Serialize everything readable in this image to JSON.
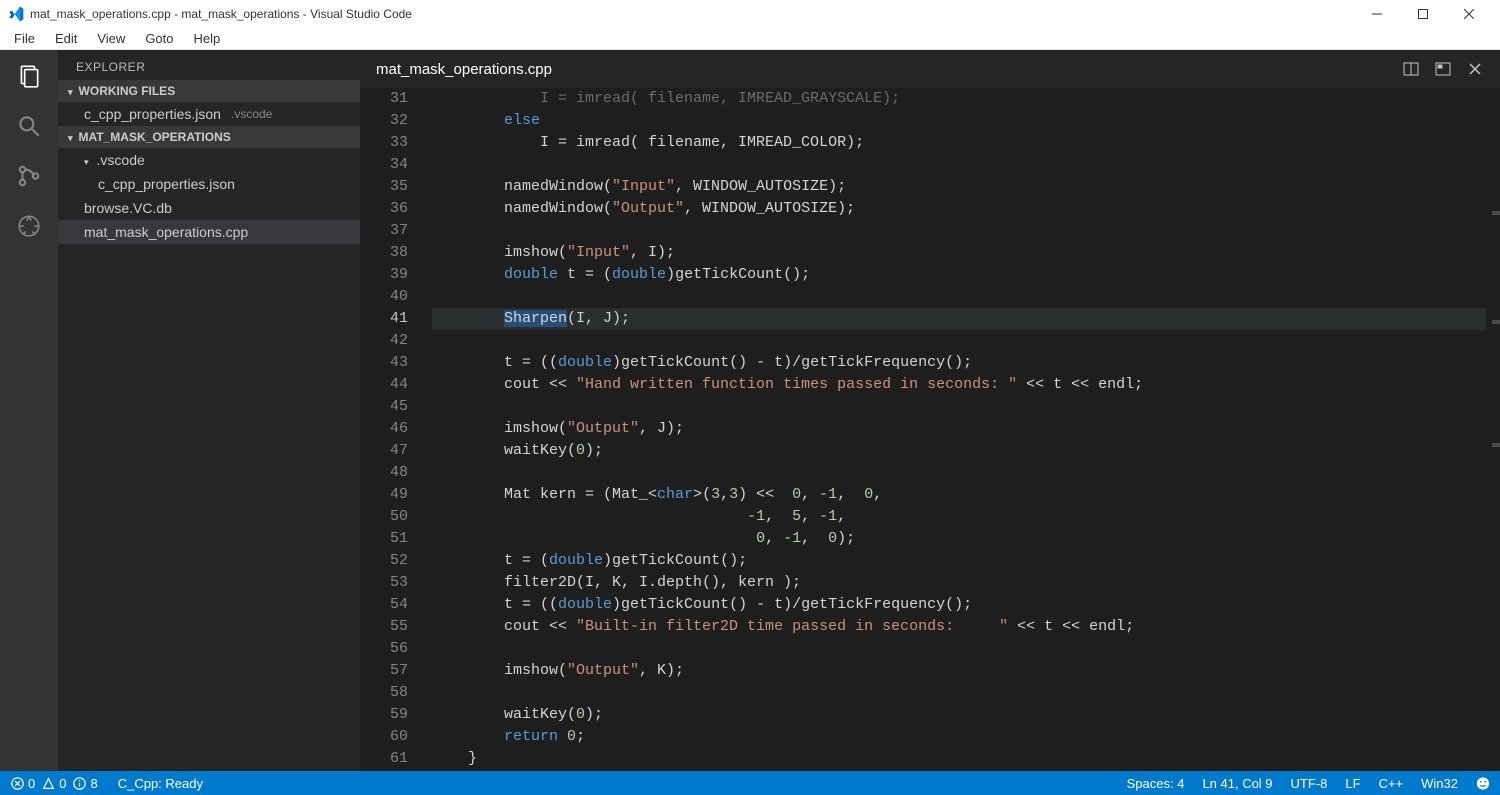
{
  "window": {
    "title": "mat_mask_operations.cpp - mat_mask_operations - Visual Studio Code"
  },
  "menu": {
    "items": [
      "File",
      "Edit",
      "View",
      "Goto",
      "Help"
    ]
  },
  "sidebar": {
    "title": "EXPLORER",
    "sections": {
      "working_files": {
        "label": "WORKING FILES",
        "items": [
          {
            "name": "c_cpp_properties.json",
            "dir": ".vscode"
          }
        ]
      },
      "project": {
        "label": "MAT_MASK_OPERATIONS",
        "items": [
          {
            "name": ".vscode",
            "kind": "folder",
            "children": [
              {
                "name": "c_cpp_properties.json",
                "kind": "file"
              }
            ]
          },
          {
            "name": "browse.VC.db",
            "kind": "file"
          },
          {
            "name": "mat_mask_operations.cpp",
            "kind": "file",
            "selected": true
          }
        ]
      }
    }
  },
  "editor": {
    "tab_title": "mat_mask_operations.cpp",
    "first_visible_line": 31,
    "current_line": 41,
    "lines": [
      {
        "n": 31,
        "tokens": [
          {
            "t": "            I = imread( filename, IMREAD_GRAYSCALE);",
            "c": ""
          }
        ],
        "dim": true
      },
      {
        "n": 32,
        "tokens": [
          {
            "t": "        ",
            "c": ""
          },
          {
            "t": "else",
            "c": "kw"
          }
        ]
      },
      {
        "n": 33,
        "tokens": [
          {
            "t": "            I = imread( filename, IMREAD_COLOR);",
            "c": ""
          }
        ]
      },
      {
        "n": 34,
        "tokens": [
          {
            "t": "",
            "c": ""
          }
        ]
      },
      {
        "n": 35,
        "tokens": [
          {
            "t": "        namedWindow(",
            "c": ""
          },
          {
            "t": "\"Input\"",
            "c": "str"
          },
          {
            "t": ", WINDOW_AUTOSIZE);",
            "c": ""
          }
        ]
      },
      {
        "n": 36,
        "tokens": [
          {
            "t": "        namedWindow(",
            "c": ""
          },
          {
            "t": "\"Output\"",
            "c": "str"
          },
          {
            "t": ", WINDOW_AUTOSIZE);",
            "c": ""
          }
        ]
      },
      {
        "n": 37,
        "tokens": [
          {
            "t": "",
            "c": ""
          }
        ]
      },
      {
        "n": 38,
        "tokens": [
          {
            "t": "        imshow(",
            "c": ""
          },
          {
            "t": "\"Input\"",
            "c": "str"
          },
          {
            "t": ", I);",
            "c": ""
          }
        ]
      },
      {
        "n": 39,
        "tokens": [
          {
            "t": "        ",
            "c": ""
          },
          {
            "t": "double",
            "c": "kw"
          },
          {
            "t": " t = (",
            "c": ""
          },
          {
            "t": "double",
            "c": "kw"
          },
          {
            "t": ")getTickCount();",
            "c": ""
          }
        ]
      },
      {
        "n": 40,
        "tokens": [
          {
            "t": "",
            "c": ""
          }
        ]
      },
      {
        "n": 41,
        "tokens": [
          {
            "t": "        ",
            "c": ""
          },
          {
            "t": "Sharpen",
            "c": "sel-hl"
          },
          {
            "t": "(I, J);",
            "c": ""
          }
        ]
      },
      {
        "n": 42,
        "tokens": [
          {
            "t": "",
            "c": ""
          }
        ]
      },
      {
        "n": 43,
        "tokens": [
          {
            "t": "        t = ((",
            "c": ""
          },
          {
            "t": "double",
            "c": "kw"
          },
          {
            "t": ")getTickCount() - t)/getTickFrequency();",
            "c": ""
          }
        ]
      },
      {
        "n": 44,
        "tokens": [
          {
            "t": "        cout << ",
            "c": ""
          },
          {
            "t": "\"Hand written function times passed in seconds: \"",
            "c": "str"
          },
          {
            "t": " << t << endl;",
            "c": ""
          }
        ]
      },
      {
        "n": 45,
        "tokens": [
          {
            "t": "",
            "c": ""
          }
        ]
      },
      {
        "n": 46,
        "tokens": [
          {
            "t": "        imshow(",
            "c": ""
          },
          {
            "t": "\"Output\"",
            "c": "str"
          },
          {
            "t": ", J);",
            "c": ""
          }
        ]
      },
      {
        "n": 47,
        "tokens": [
          {
            "t": "        waitKey(",
            "c": ""
          },
          {
            "t": "0",
            "c": "num"
          },
          {
            "t": ");",
            "c": ""
          }
        ]
      },
      {
        "n": 48,
        "tokens": [
          {
            "t": "",
            "c": ""
          }
        ]
      },
      {
        "n": 49,
        "tokens": [
          {
            "t": "        Mat kern = (Mat_<",
            "c": ""
          },
          {
            "t": "char",
            "c": "kw"
          },
          {
            "t": ">(",
            "c": ""
          },
          {
            "t": "3",
            "c": "num"
          },
          {
            "t": ",",
            "c": ""
          },
          {
            "t": "3",
            "c": "num"
          },
          {
            "t": ") <<  ",
            "c": ""
          },
          {
            "t": "0",
            "c": "num"
          },
          {
            "t": ", ",
            "c": ""
          },
          {
            "t": "-1",
            "c": "num"
          },
          {
            "t": ",  ",
            "c": ""
          },
          {
            "t": "0",
            "c": "num"
          },
          {
            "t": ",",
            "c": ""
          }
        ]
      },
      {
        "n": 50,
        "tokens": [
          {
            "t": "                                   ",
            "c": ""
          },
          {
            "t": "-1",
            "c": "num"
          },
          {
            "t": ",  ",
            "c": ""
          },
          {
            "t": "5",
            "c": "num"
          },
          {
            "t": ", ",
            "c": ""
          },
          {
            "t": "-1",
            "c": "num"
          },
          {
            "t": ",",
            "c": ""
          }
        ]
      },
      {
        "n": 51,
        "tokens": [
          {
            "t": "                                    ",
            "c": ""
          },
          {
            "t": "0",
            "c": "num"
          },
          {
            "t": ", ",
            "c": ""
          },
          {
            "t": "-1",
            "c": "num"
          },
          {
            "t": ",  ",
            "c": ""
          },
          {
            "t": "0",
            "c": "num"
          },
          {
            "t": ");",
            "c": ""
          }
        ]
      },
      {
        "n": 52,
        "tokens": [
          {
            "t": "        t = (",
            "c": ""
          },
          {
            "t": "double",
            "c": "kw"
          },
          {
            "t": ")getTickCount();",
            "c": ""
          }
        ]
      },
      {
        "n": 53,
        "tokens": [
          {
            "t": "        filter2D(I, K, I.depth(), kern );",
            "c": ""
          }
        ]
      },
      {
        "n": 54,
        "tokens": [
          {
            "t": "        t = ((",
            "c": ""
          },
          {
            "t": "double",
            "c": "kw"
          },
          {
            "t": ")getTickCount() - t)/getTickFrequency();",
            "c": ""
          }
        ]
      },
      {
        "n": 55,
        "tokens": [
          {
            "t": "        cout << ",
            "c": ""
          },
          {
            "t": "\"Built-in filter2D time passed in seconds:     \"",
            "c": "str"
          },
          {
            "t": " << t << endl;",
            "c": ""
          }
        ]
      },
      {
        "n": 56,
        "tokens": [
          {
            "t": "",
            "c": ""
          }
        ]
      },
      {
        "n": 57,
        "tokens": [
          {
            "t": "        imshow(",
            "c": ""
          },
          {
            "t": "\"Output\"",
            "c": "str"
          },
          {
            "t": ", K);",
            "c": ""
          }
        ]
      },
      {
        "n": 58,
        "tokens": [
          {
            "t": "",
            "c": ""
          }
        ]
      },
      {
        "n": 59,
        "tokens": [
          {
            "t": "        waitKey(",
            "c": ""
          },
          {
            "t": "0",
            "c": "num"
          },
          {
            "t": ");",
            "c": ""
          }
        ]
      },
      {
        "n": 60,
        "tokens": [
          {
            "t": "        ",
            "c": ""
          },
          {
            "t": "return",
            "c": "kw"
          },
          {
            "t": " ",
            "c": ""
          },
          {
            "t": "0",
            "c": "num"
          },
          {
            "t": ";",
            "c": ""
          }
        ]
      },
      {
        "n": 61,
        "tokens": [
          {
            "t": "    }",
            "c": ""
          }
        ]
      }
    ]
  },
  "status": {
    "errors": "0",
    "warnings": "0",
    "info": "8",
    "mode_msg": "C_Cpp: Ready",
    "spaces": "Spaces: 4",
    "cursor": "Ln 41, Col 9",
    "encoding": "UTF-8",
    "eol": "LF",
    "lang": "C++",
    "platform": "Win32"
  }
}
